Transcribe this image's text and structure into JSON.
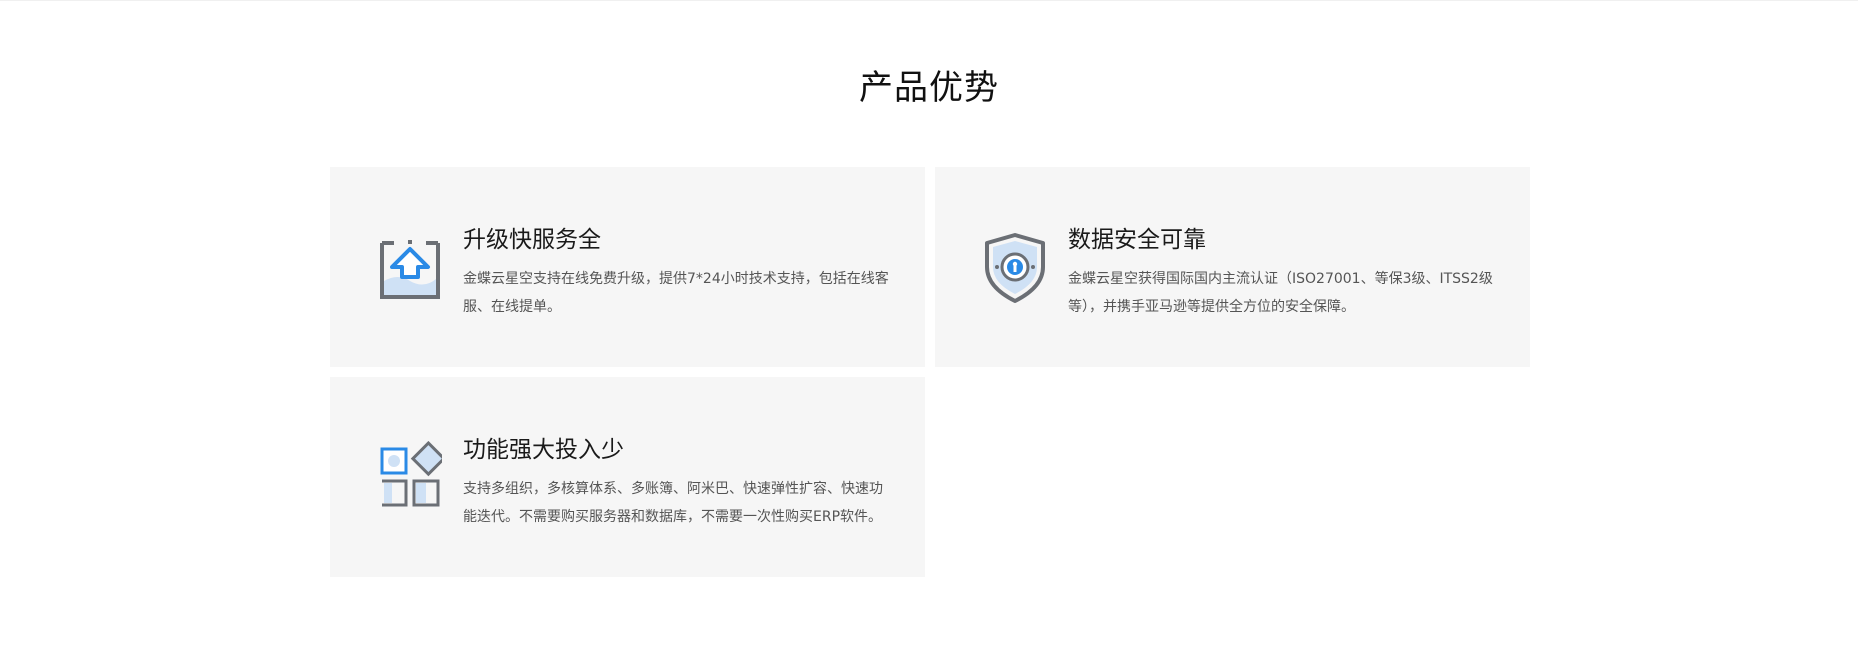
{
  "section": {
    "title": "产品优势"
  },
  "cards": [
    {
      "title": "升级快服务全",
      "description": "金蝶云星空支持在线免费升级，提供7*24小时技术支持，包括在线客服、在线提单。",
      "icon": "upgrade-icon"
    },
    {
      "title": "数据安全可靠",
      "description": "金蝶云星空获得国际国内主流认证（ISO27001、等保3级、ITSS2级等），并携手亚马逊等提供全方位的安全保障。",
      "icon": "shield-lock-icon"
    },
    {
      "title": "功能强大投入少",
      "description": "支持多组织，多核算体系、多账簿、阿米巴、快速弹性扩容、快速功能迭代。不需要购买服务器和数据库，不需要一次性购买ERP软件。",
      "icon": "modules-icon"
    }
  ],
  "colors": {
    "accent_blue": "#2a8ae6",
    "icon_gray": "#6b6f75",
    "card_bg": "#f6f6f6"
  }
}
